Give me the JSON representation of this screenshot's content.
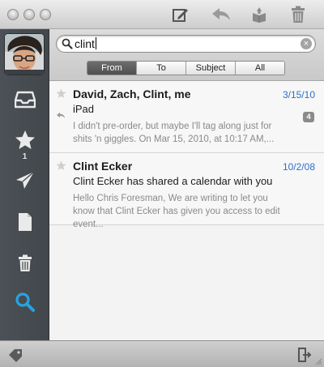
{
  "toolbar": {
    "icons": [
      "compose-icon",
      "reply-icon",
      "archive-icon",
      "trash-icon"
    ]
  },
  "sidebar": {
    "starred_count": "1",
    "items": [
      "inbox-icon",
      "star-icon",
      "sent-icon",
      "drafts-icon",
      "trash-icon",
      "search-icon"
    ],
    "active": "search"
  },
  "search": {
    "query": "clint",
    "scopes": [
      "From",
      "To",
      "Subject",
      "All"
    ],
    "active_scope": "From"
  },
  "messages": [
    {
      "from": "David, Zach, Clint, me",
      "date": "3/15/10",
      "subject": "iPad",
      "preview": "I didn't pre-order, but maybe I'll tag along just for shits 'n giggles. On Mar 15, 2010, at 10:17 AM,...",
      "thread_count": "4",
      "replied": true
    },
    {
      "from": "Clint Ecker",
      "date": "10/2/08",
      "subject": "Clint Ecker has shared a calendar with you",
      "preview": "Hello Chris Foresman, We are writing to let you know that Clint Ecker has given you access to edit event...",
      "replied": false
    }
  ],
  "colors": {
    "accent_blue": "#2d6fc9",
    "search_active": "#27a4e0",
    "sidebar_bg": "#464c50"
  }
}
